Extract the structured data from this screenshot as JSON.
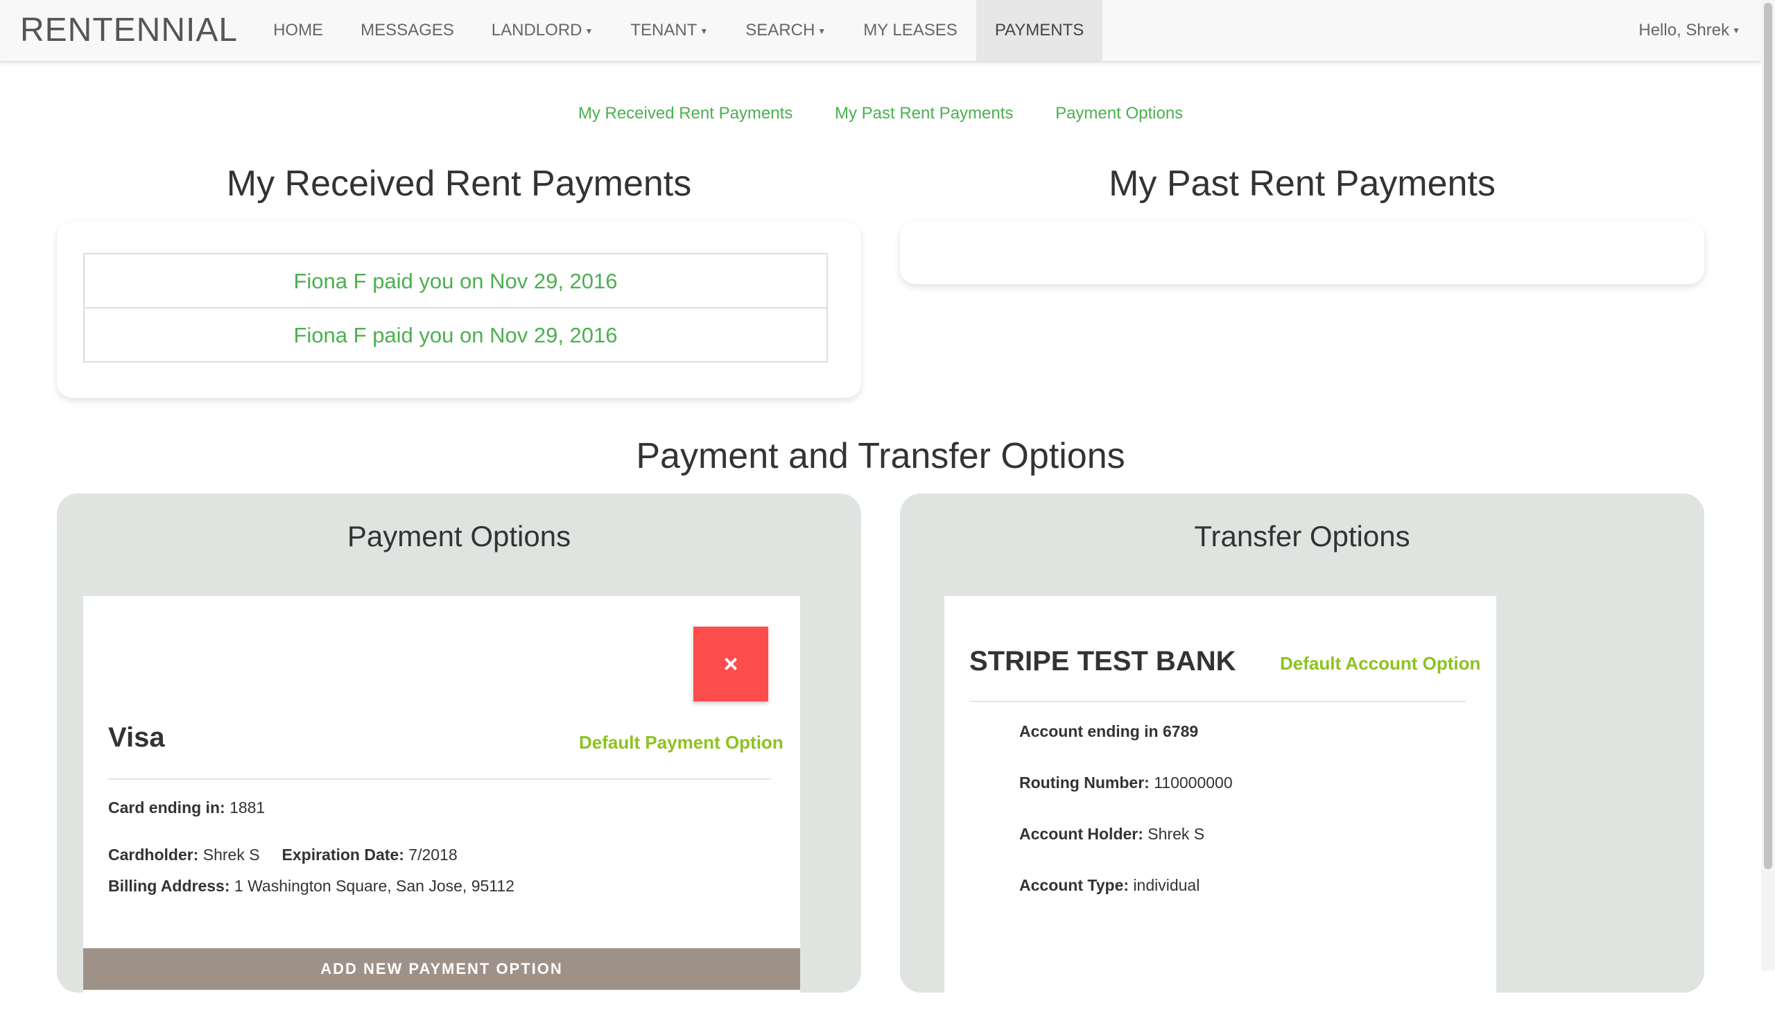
{
  "nav": {
    "brand": "RENTENNIAL",
    "items": [
      {
        "label": "HOME",
        "dropdown": false
      },
      {
        "label": "MESSAGES",
        "dropdown": false
      },
      {
        "label": "LANDLORD",
        "dropdown": true
      },
      {
        "label": "TENANT",
        "dropdown": true
      },
      {
        "label": "SEARCH",
        "dropdown": true
      },
      {
        "label": "MY LEASES",
        "dropdown": false
      },
      {
        "label": "PAYMENTS",
        "dropdown": false,
        "active": true
      }
    ],
    "user_greeting": "Hello, Shrek"
  },
  "subnav": {
    "received": "My Received Rent Payments",
    "past": "My Past Rent Payments",
    "options": "Payment Options"
  },
  "received": {
    "title": "My Received Rent Payments",
    "payments": [
      "Fiona F paid you on Nov 29, 2016",
      "Fiona F paid you on Nov 29, 2016"
    ]
  },
  "past": {
    "title": "My Past Rent Payments"
  },
  "options_section": {
    "title": "Payment and Transfer Options"
  },
  "payment_options": {
    "title": "Payment Options",
    "delete_icon": "×",
    "card": {
      "brand": "Visa",
      "default_label": "Default Payment Option",
      "card_ending_label": "Card ending in:",
      "card_ending_value": "1881",
      "cardholder_label": "Cardholder:",
      "cardholder_value": "Shrek S",
      "expiration_label": "Expiration Date:",
      "expiration_value": "7/2018",
      "billing_label": "Billing Address:",
      "billing_value": "1 Washington Square, San Jose, 95112"
    },
    "add_button": "ADD NEW PAYMENT OPTION"
  },
  "transfer_options": {
    "title": "Transfer Options",
    "bank": {
      "name": "STRIPE TEST BANK",
      "default_label": "Default Account Option",
      "account_ending": "Account ending in 6789",
      "routing_label": "Routing Number:",
      "routing_value": "110000000",
      "holder_label": "Account Holder:",
      "holder_value": "Shrek S",
      "type_label": "Account Type:",
      "type_value": "individual"
    }
  },
  "colors": {
    "accent_green": "#4caf50",
    "default_green": "#8dc21f",
    "delete_red": "#fc4c4c",
    "panel_grey": "#e0e4e1",
    "add_button": "#9e9188"
  }
}
